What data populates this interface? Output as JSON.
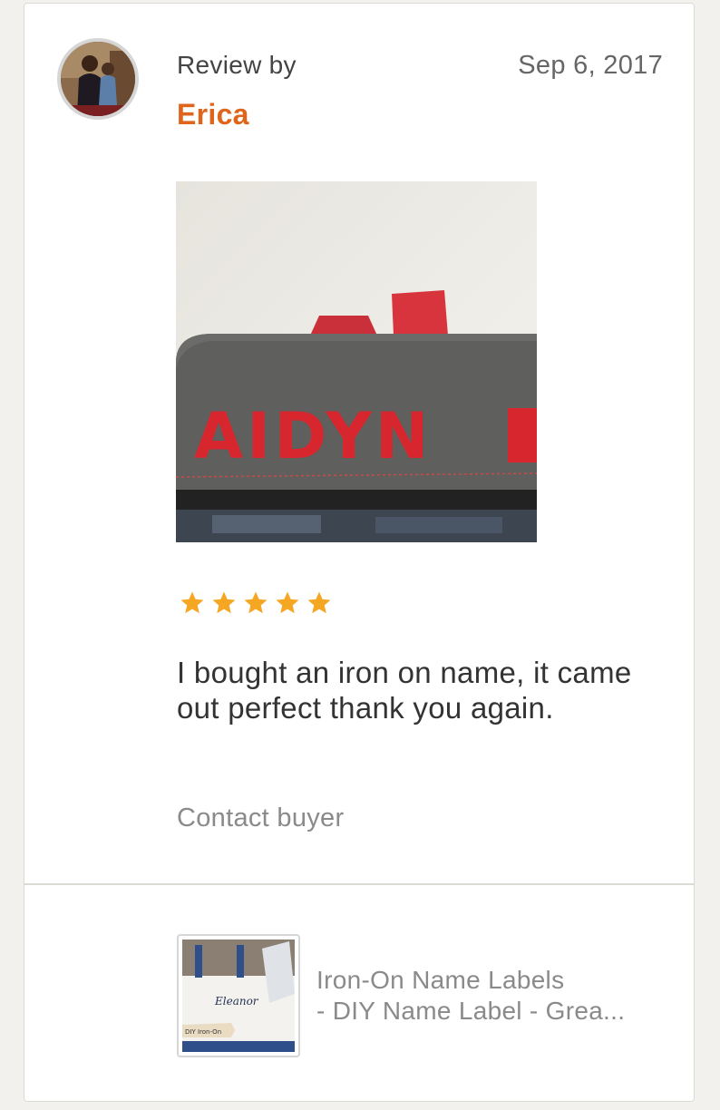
{
  "review": {
    "prefix": "Review by",
    "reviewer_name": "Erica",
    "date": "Sep 6, 2017",
    "rating": 5,
    "rating_max": 5,
    "text": "I bought an iron on name, it came out perfect thank you again.",
    "photo_text": "AIDYN",
    "contact_label": "Contact buyer"
  },
  "listing": {
    "title_line1": "Iron-On Name Labels",
    "title_line2": "- DIY Name Label - Grea...",
    "thumb_name_text": "Eleanor",
    "thumb_tag_text": "DIY Iron-On"
  },
  "colors": {
    "accent": "#e0651c",
    "star": "#f5a623",
    "muted_text": "#8a8a8a",
    "bag_gray": "#5f5f5d",
    "letter_red": "#d8262e"
  },
  "icons": {
    "star": "star-icon",
    "avatar": "avatar-photo"
  }
}
